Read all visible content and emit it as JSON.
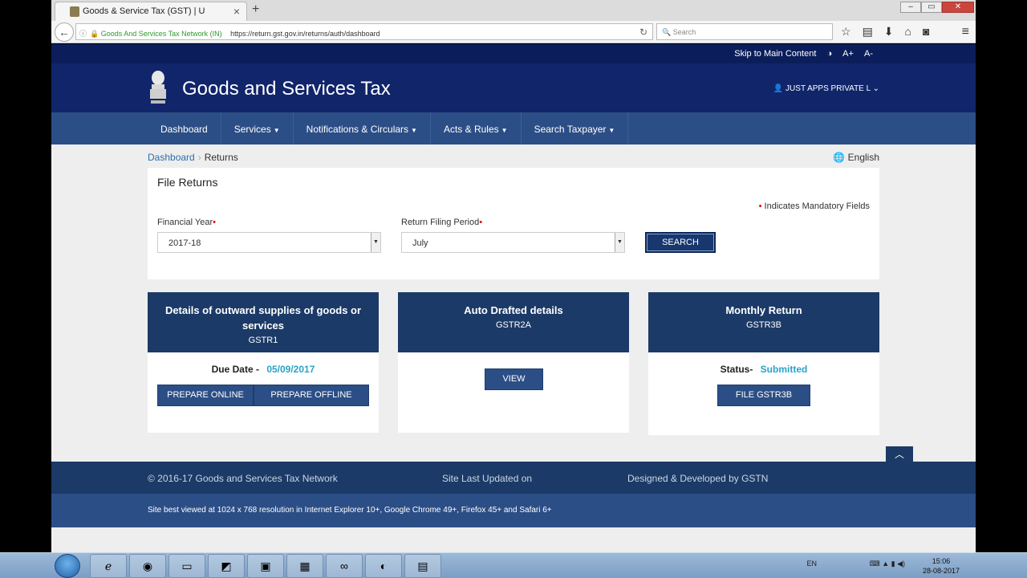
{
  "browser": {
    "tab_title": "Goods & Service Tax (GST) | U",
    "tab_close": "×",
    "new_tab": "+",
    "site_identity": "Goods And Services Tax Network (IN)",
    "url": "https://return.gst.gov.in/returns/auth/dashboard",
    "search_placeholder": "Search"
  },
  "page": {
    "top_links": {
      "skip": "Skip to Main Content",
      "contrast": "◑",
      "font_increase": "A+",
      "font_decrease": "A-"
    },
    "site_title": "Goods and Services Tax",
    "user": "JUST APPS PRIVATE L",
    "nav": [
      {
        "label": "Dashboard",
        "dropdown": false
      },
      {
        "label": "Services",
        "dropdown": true
      },
      {
        "label": "Notifications & Circulars",
        "dropdown": true
      },
      {
        "label": "Acts & Rules",
        "dropdown": true
      },
      {
        "label": "Search Taxpayer",
        "dropdown": true
      }
    ],
    "breadcrumb": {
      "home": "Dashboard",
      "current": "Returns"
    },
    "language": "English",
    "file_returns": {
      "title": "File Returns",
      "mandatory_note": "Indicates Mandatory Fields",
      "financial_year_label": "Financial Year",
      "financial_year_value": "2017-18",
      "period_label": "Return Filing Period",
      "period_value": "July",
      "search_button": "SEARCH"
    },
    "cards": [
      {
        "title": "Details of outward supplies of goods or services",
        "form": "GSTR1",
        "due_label": "Due Date -",
        "due_value": "05/09/2017",
        "btn_online": "PREPARE ONLINE",
        "btn_offline": "PREPARE OFFLINE"
      },
      {
        "title": "Auto Drafted details",
        "form": "GSTR2A",
        "btn_view": "VIEW"
      },
      {
        "title": "Monthly Return",
        "form": "GSTR3B",
        "status_label": "Status-",
        "status_value": "Submitted",
        "btn_file": "FILE GSTR3B"
      }
    ],
    "footer": {
      "copyright": "© 2016-17 Goods and Services Tax Network",
      "updated": "Site Last Updated on",
      "designed": "Designed & Developed by GSTN",
      "best_viewed": "Site best viewed at 1024 x 768 resolution in Internet Explorer 10+, Google Chrome 49+, Firefox 45+ and Safari 6+"
    }
  },
  "taskbar": {
    "lang": "EN",
    "time": "15:06",
    "date": "28-08-2017"
  },
  "colors": {
    "header_dark": "#11256b",
    "nav_blue": "#2c4e86",
    "card_head": "#1b3a67",
    "accent_cyan": "#2aa3c8"
  }
}
